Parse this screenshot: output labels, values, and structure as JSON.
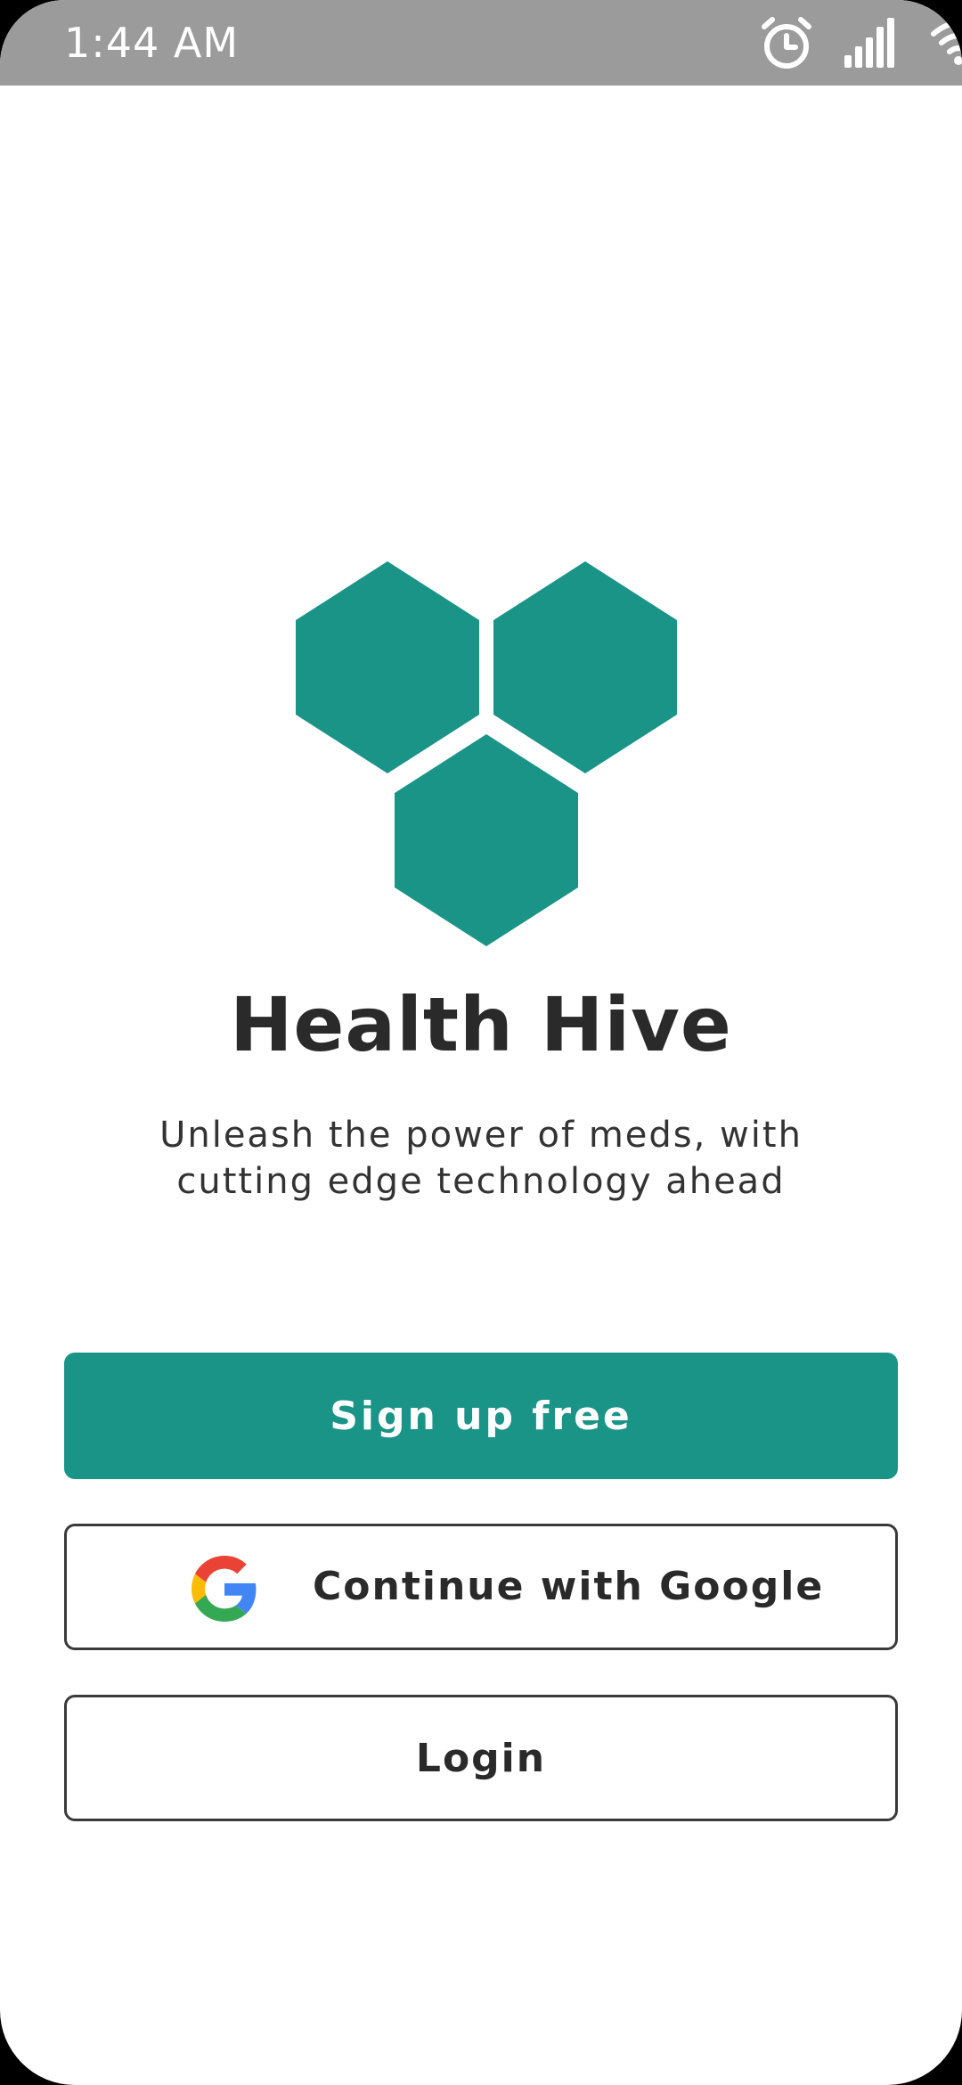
{
  "status_bar": {
    "time": "1:44 AM",
    "icons": [
      "alarm-icon",
      "signal-icon",
      "wifi-icon",
      "battery-icon"
    ]
  },
  "app": {
    "name": "Health Hive",
    "tagline_lines": [
      "Unleash the power of meds, with",
      "cutting edge technology ahead"
    ]
  },
  "buttons": {
    "signup": "Sign up free",
    "google": "Continue with Google",
    "login": "Login"
  },
  "colors": {
    "brand": "#1b9488",
    "status_bar": "#9b9b9b",
    "text": "#2a2a2a",
    "border": "#3a3a3a"
  }
}
